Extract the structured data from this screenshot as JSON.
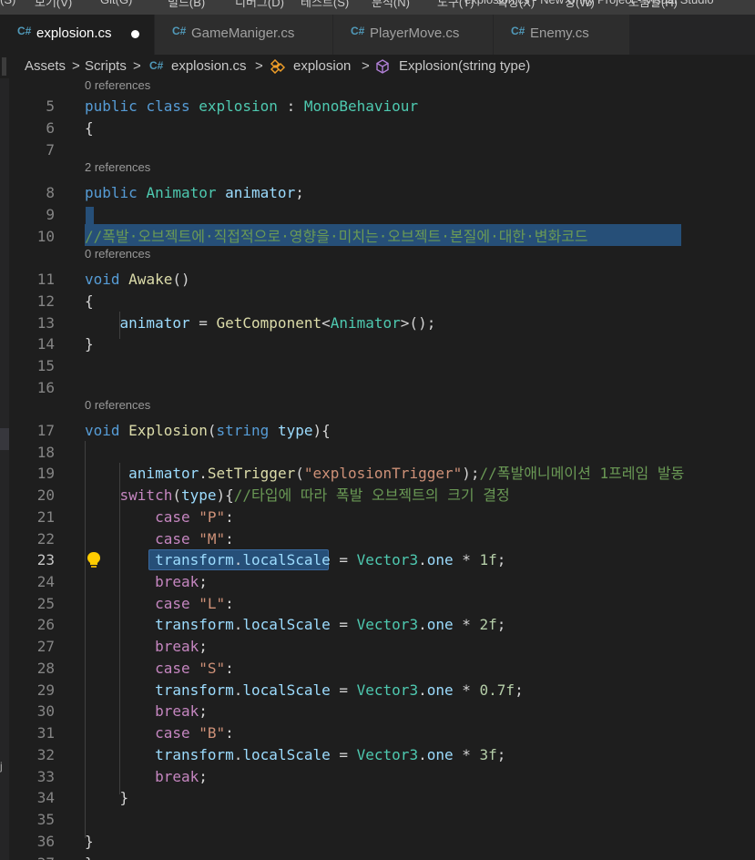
{
  "menu": [
    "(S)",
    "보기(V)",
    "Git(G)",
    "빌드(B)",
    "디버그(D)",
    "테스트(S)",
    "분석(N)",
    "도구(T)",
    "확장(X)",
    "창(W)",
    "도움말(H)",
    "explosion.cs - New Unity Project - Visual Studio"
  ],
  "tabs": [
    {
      "label": "explosion.cs",
      "active": true,
      "modified": true
    },
    {
      "label": "GameManiger.cs",
      "active": false
    },
    {
      "label": "PlayerMove.cs",
      "active": false
    },
    {
      "label": "Enemy.cs",
      "active": false
    }
  ],
  "tab_icon": "C#",
  "breadcrumb": {
    "assets": "Assets",
    "sep": ">",
    "scripts": "Scripts",
    "file": "explosion.cs",
    "class": "explosion",
    "method": "Explosion(string type)"
  },
  "current_line": "23",
  "lines": [
    {
      "lens": "0 references"
    },
    {
      "n": "5",
      "tokens": [
        [
          "k",
          "public "
        ],
        [
          "k",
          "class "
        ],
        [
          "t",
          "explosion"
        ],
        [
          "p",
          " : "
        ],
        [
          "t",
          "MonoBehaviour"
        ]
      ]
    },
    {
      "n": "6",
      "tokens": [
        [
          "p",
          "{"
        ]
      ]
    },
    {
      "n": "7",
      "tokens": []
    },
    {
      "lens": "2 references"
    },
    {
      "n": "8",
      "tokens": [
        [
          "k",
          "public "
        ],
        [
          "t",
          "Animator"
        ],
        [
          "v",
          " animator"
        ],
        [
          "p",
          ";"
        ]
      ]
    },
    {
      "n": "9",
      "tokens": []
    },
    {
      "n": "10",
      "tokens": [
        [
          "c",
          "//폭발·오브젝트에·직접적으로·영향을·미치는·오브젝트·본질에·대한·변화코드"
        ]
      ]
    },
    {
      "lens": "0 references"
    },
    {
      "n": "11",
      "tokens": [
        [
          "k",
          "void "
        ],
        [
          "f",
          "Awake"
        ],
        [
          "p",
          "()"
        ]
      ]
    },
    {
      "n": "12",
      "tokens": [
        [
          "p",
          "{"
        ]
      ]
    },
    {
      "n": "13",
      "tokens": [
        [
          "v",
          "    animator"
        ],
        [
          "p",
          " = "
        ],
        [
          "f",
          "GetComponent"
        ],
        [
          "p",
          "<"
        ],
        [
          "t",
          "Animator"
        ],
        [
          "p",
          ">();"
        ]
      ]
    },
    {
      "n": "14",
      "tokens": [
        [
          "p",
          "}"
        ]
      ]
    },
    {
      "n": "15",
      "tokens": []
    },
    {
      "n": "16",
      "tokens": []
    },
    {
      "lens": "0 references"
    },
    {
      "n": "17",
      "tokens": [
        [
          "k",
          "void "
        ],
        [
          "f",
          "Explosion"
        ],
        [
          "p",
          "("
        ],
        [
          "k",
          "string "
        ],
        [
          "v",
          "type"
        ],
        [
          "p",
          "){"
        ]
      ]
    },
    {
      "n": "18",
      "tokens": []
    },
    {
      "n": "19",
      "tokens": [
        [
          "v",
          "     animator"
        ],
        [
          "p",
          "."
        ],
        [
          "f",
          "SetTrigger"
        ],
        [
          "p",
          "("
        ],
        [
          "s",
          "\"explosionTrigger\""
        ],
        [
          "p",
          ");"
        ],
        [
          "c",
          "//폭발애니메이션 1프레임 발동"
        ]
      ]
    },
    {
      "n": "20",
      "tokens": [
        [
          "ct",
          "    switch"
        ],
        [
          "p",
          "("
        ],
        [
          "v",
          "type"
        ],
        [
          "p",
          "){"
        ],
        [
          "c",
          "//타입에 따라 폭발 오브젝트의 크기 결정"
        ]
      ]
    },
    {
      "n": "21",
      "tokens": [
        [
          "ct",
          "        case "
        ],
        [
          "s",
          "\"P\""
        ],
        [
          "p",
          ":"
        ]
      ]
    },
    {
      "n": "22",
      "tokens": [
        [
          "ct",
          "        case "
        ],
        [
          "s",
          "\"M\""
        ],
        [
          "p",
          ":"
        ]
      ]
    },
    {
      "n": "23",
      "tokens": [
        [
          "v",
          "        transform"
        ],
        [
          "p",
          "."
        ],
        [
          "v",
          "localScale"
        ],
        [
          "p",
          " = "
        ],
        [
          "t",
          "Vector3"
        ],
        [
          "p",
          "."
        ],
        [
          "v",
          "one"
        ],
        [
          "p",
          " * "
        ],
        [
          "n",
          "1f"
        ],
        [
          "p",
          ";"
        ]
      ]
    },
    {
      "n": "24",
      "tokens": [
        [
          "ct",
          "        break"
        ],
        [
          "p",
          ";"
        ]
      ]
    },
    {
      "n": "25",
      "tokens": [
        [
          "ct",
          "        case "
        ],
        [
          "s",
          "\"L\""
        ],
        [
          "p",
          ":"
        ]
      ]
    },
    {
      "n": "26",
      "tokens": [
        [
          "v",
          "        transform"
        ],
        [
          "p",
          "."
        ],
        [
          "v",
          "localScale"
        ],
        [
          "p",
          " = "
        ],
        [
          "t",
          "Vector3"
        ],
        [
          "p",
          "."
        ],
        [
          "v",
          "one"
        ],
        [
          "p",
          " * "
        ],
        [
          "n",
          "2f"
        ],
        [
          "p",
          ";"
        ]
      ]
    },
    {
      "n": "27",
      "tokens": [
        [
          "ct",
          "        break"
        ],
        [
          "p",
          ";"
        ]
      ]
    },
    {
      "n": "28",
      "tokens": [
        [
          "ct",
          "        case "
        ],
        [
          "s",
          "\"S\""
        ],
        [
          "p",
          ":"
        ]
      ]
    },
    {
      "n": "29",
      "tokens": [
        [
          "v",
          "        transform"
        ],
        [
          "p",
          "."
        ],
        [
          "v",
          "localScale"
        ],
        [
          "p",
          " = "
        ],
        [
          "t",
          "Vector3"
        ],
        [
          "p",
          "."
        ],
        [
          "v",
          "one"
        ],
        [
          "p",
          " * "
        ],
        [
          "n",
          "0.7f"
        ],
        [
          "p",
          ";"
        ]
      ]
    },
    {
      "n": "30",
      "tokens": [
        [
          "ct",
          "        break"
        ],
        [
          "p",
          ";"
        ]
      ]
    },
    {
      "n": "31",
      "tokens": [
        [
          "ct",
          "        case "
        ],
        [
          "s",
          "\"B\""
        ],
        [
          "p",
          ":"
        ]
      ]
    },
    {
      "n": "32",
      "tokens": [
        [
          "v",
          "        transform"
        ],
        [
          "p",
          "."
        ],
        [
          "v",
          "localScale"
        ],
        [
          "p",
          " = "
        ],
        [
          "t",
          "Vector3"
        ],
        [
          "p",
          "."
        ],
        [
          "v",
          "one"
        ],
        [
          "p",
          " * "
        ],
        [
          "n",
          "3f"
        ],
        [
          "p",
          ";"
        ]
      ]
    },
    {
      "n": "33",
      "tokens": [
        [
          "ct",
          "        break"
        ],
        [
          "p",
          ";"
        ]
      ]
    },
    {
      "n": "34",
      "tokens": [
        [
          "p",
          "    }"
        ]
      ]
    },
    {
      "n": "35",
      "tokens": []
    },
    {
      "n": "36",
      "tokens": [
        [
          "p",
          "}"
        ]
      ]
    },
    {
      "n": "37",
      "tokens": [
        [
          "p",
          "}"
        ]
      ]
    }
  ],
  "left_strip_chars": [
    "j"
  ],
  "colors": {
    "accent": "#007acc",
    "selection": "#264f78",
    "comment": "#6a9955",
    "keyword": "#569cd6",
    "type": "#4ec9b0",
    "string": "#ce9178"
  }
}
